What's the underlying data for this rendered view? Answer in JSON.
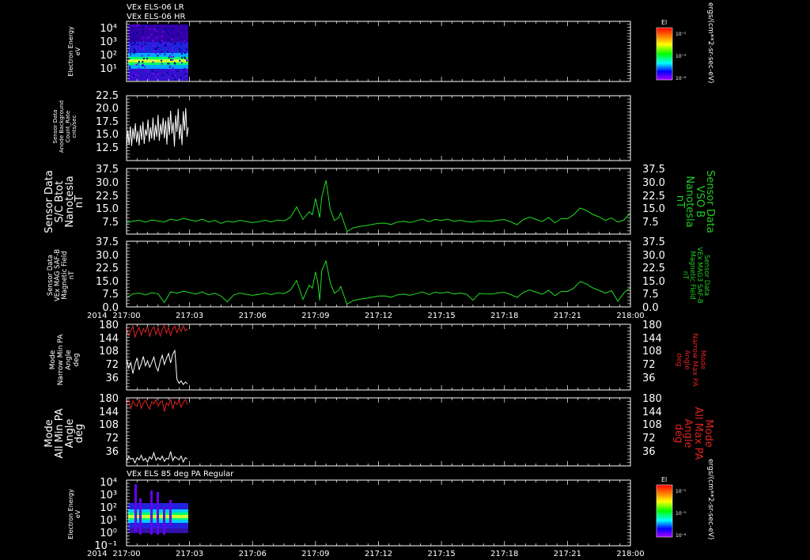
{
  "colors": {
    "background": "#000000",
    "frame": "#ffffff",
    "b_trace": "#22dd22",
    "max_pa": "#dd2222",
    "min_pa": "#ffffff",
    "label_green": "#22cc22",
    "label_red": "#dd2222"
  },
  "header": {
    "line1": "VEx ELS-06 LR",
    "line2": "VEx ELS-06 HR",
    "panel6_title": "VEx ELS 85 deg PA Regular"
  },
  "panels": [
    {
      "id": "p1",
      "ylabel": [
        "Electron Energy",
        "eV"
      ],
      "yticks": [
        "10⁴",
        "10³",
        "10²",
        "10¹"
      ],
      "colorbar": {
        "title": "El",
        "ticks": [
          "10⁻¹",
          "10⁻⁵",
          "10⁻⁹"
        ]
      },
      "units": "ergs/(cm**2-sr-sec-eV)"
    },
    {
      "id": "p2",
      "ylabel": [
        "Sensor Data",
        "Anode Background",
        "Count_Rate",
        "cnts/sec"
      ],
      "yticks": [
        "22.5",
        "20.0",
        "17.5",
        "15.0",
        "12.5"
      ]
    },
    {
      "id": "p3",
      "ylabel": [
        "Sensor Data",
        "S/C Btot",
        "Nanotesla",
        "nT"
      ],
      "yticks": [
        "37.5",
        "30.0",
        "22.5",
        "15.0",
        "7.5"
      ],
      "ylabel_right": [
        "Sensor Data",
        "VSO B",
        "Nanotesla",
        "nT"
      ]
    },
    {
      "id": "p4",
      "ylabel": [
        "Sensor Data",
        "VEx MAG SAF-B",
        "Magnetic Field",
        "nT"
      ],
      "yticks": [
        "37.5",
        "30.0",
        "22.5",
        "15.0",
        "7.5",
        "0.0"
      ],
      "ylabel_right": [
        "Sensor Data",
        "VEx MAG3 SAF-B",
        "Magnetic Field",
        "nT"
      ]
    },
    {
      "id": "p5",
      "ylabel": [
        "Mode",
        "Narrow Min PA",
        "Angle",
        "deg"
      ],
      "yticks": [
        "180",
        "144",
        "108",
        "72",
        "36"
      ],
      "ylabel_right": [
        "Mode",
        "Narrow Max PA",
        "Angle",
        "deg"
      ]
    },
    {
      "id": "p6",
      "ylabel": [
        "Mode",
        "All Min PA",
        "Angle",
        "deg"
      ],
      "yticks": [
        "180",
        "144",
        "108",
        "72",
        "36"
      ],
      "ylabel_right": [
        "Mode",
        "All Max PA",
        "Angle",
        "deg"
      ]
    },
    {
      "id": "p7",
      "ylabel": [
        "Electron Energy",
        "eV"
      ],
      "yticks": [
        "10⁴",
        "10³",
        "10²",
        "10¹",
        "10⁰",
        "10⁻¹"
      ],
      "colorbar": {
        "title": "El",
        "ticks": [
          "10⁻¹",
          "10⁻⁵",
          "10⁻⁹"
        ]
      },
      "units": "ergs/(cm**2-sr-sec-eV)"
    }
  ],
  "xaxis": {
    "year": "2014",
    "ticks": [
      "217:00",
      "217:03",
      "217:06",
      "217:09",
      "217:12",
      "217:15",
      "217:18",
      "217:21",
      "218:00"
    ]
  },
  "chart_data": [
    {
      "type": "heatmap",
      "panel": "p1",
      "title": "VEx ELS-06 LR",
      "x_range": [
        "217:00",
        "217:03"
      ],
      "y_range": [
        "10¹",
        "10⁴"
      ],
      "ylabel": "Electron Energy eV",
      "y_scale": "log",
      "legend": "colorbar right"
    },
    {
      "type": "line",
      "panel": "p2",
      "ylabel": "Sensor Data Anode Background Count_Rate cnts/sec",
      "ylim": [
        10,
        22.5
      ],
      "x": [
        0.0,
        0.06,
        0.12,
        0.18,
        0.24,
        0.3,
        0.36,
        0.42,
        0.48,
        0.54,
        0.6,
        0.66,
        0.72,
        0.78,
        0.84,
        0.9,
        0.96,
        1.02,
        1.08,
        1.14,
        1.2,
        1.26,
        1.32,
        1.38,
        1.44,
        1.5,
        1.56,
        1.62,
        1.68,
        1.74,
        1.8,
        1.86,
        1.92,
        1.98,
        2.04,
        2.1,
        2.16,
        2.22,
        2.28,
        2.34,
        2.4,
        2.46,
        2.52,
        2.58,
        2.64,
        2.7,
        2.76,
        2.82,
        2.88,
        2.94
      ],
      "series": [
        {
          "values": [
            12.3,
            15.8,
            13.0,
            16.6,
            12.8,
            16.2,
            14.1,
            17.2,
            13.5,
            15.7,
            12.9,
            16.8,
            14.0,
            17.5,
            13.2,
            16.0,
            14.8,
            17.9,
            13.6,
            16.4,
            14.2,
            18.3,
            13.9,
            16.9,
            14.6,
            18.8,
            13.8,
            17.1,
            15.0,
            18.2,
            14.3,
            17.7,
            13.1,
            18.4,
            14.9,
            19.6,
            15.2,
            17.4,
            12.7,
            18.7,
            15.5,
            20.0,
            14.1,
            17.0,
            13.0,
            19.5,
            15.8,
            20.1,
            14.6,
            16.4
          ]
        }
      ]
    },
    {
      "type": "line",
      "panel": "p3",
      "ylabel": "Sensor Data S/C Btot Nanotesla nT",
      "ylim": [
        0,
        37.5
      ],
      "x": [
        0.0,
        0.3,
        0.6,
        0.9,
        1.2,
        1.5,
        1.8,
        2.1,
        2.4,
        2.7,
        3.0,
        3.3,
        3.6,
        3.9,
        4.2,
        4.5,
        4.8,
        5.1,
        5.4,
        5.7,
        6.0,
        6.3,
        6.6,
        6.9,
        7.2,
        7.5,
        7.8,
        8.1,
        8.4,
        8.7,
        8.85,
        9.0,
        9.1,
        9.2,
        9.3,
        9.5,
        9.7,
        9.9,
        10.1,
        10.2,
        10.5,
        10.8,
        11.1,
        11.4,
        11.7,
        12.0,
        12.3,
        12.6,
        12.9,
        13.2,
        13.5,
        13.8,
        14.1,
        14.4,
        14.7,
        15.0,
        15.3,
        15.6,
        15.9,
        16.2,
        16.5,
        16.8,
        17.1,
        17.4,
        17.7,
        18.0,
        18.3,
        18.6,
        18.9,
        19.2,
        19.5,
        19.8,
        20.1,
        20.4,
        20.7,
        21.0,
        21.3,
        21.6,
        21.9,
        22.2,
        22.5,
        22.8,
        23.1,
        23.4,
        23.7,
        24.0
      ],
      "series": [
        {
          "values": [
            6.5,
            7.4,
            7.9,
            6.8,
            8.1,
            7.5,
            7.0,
            8.6,
            7.8,
            9.0,
            8.2,
            7.3,
            8.6,
            6.9,
            7.8,
            6.2,
            7.4,
            6.8,
            7.9,
            7.2,
            6.6,
            7.1,
            7.9,
            7.0,
            8.1,
            7.6,
            9.5,
            15.5,
            8.4,
            12.8,
            11.1,
            20.4,
            15.2,
            9.4,
            21.2,
            30.7,
            14.2,
            7.8,
            9.4,
            12.1,
            1.6,
            3.6,
            4.4,
            4.9,
            5.5,
            6.2,
            6.3,
            5.5,
            6.9,
            7.3,
            6.6,
            7.6,
            8.6,
            7.1,
            8.4,
            7.8,
            8.6,
            7.3,
            7.9,
            7.2,
            6.8,
            7.7,
            7.4,
            7.3,
            8.0,
            8.3,
            7.0,
            5.4,
            8.3,
            9.7,
            8.4,
            7.2,
            9.5,
            6.4,
            8.8,
            8.8,
            11.1,
            14.9,
            13.5,
            11.3,
            9.9,
            7.8,
            9.3,
            6.8,
            8.2,
            12.0
          ]
        }
      ]
    },
    {
      "type": "line",
      "panel": "p4",
      "ylabel": "Sensor Data VEx MAG SAF-B Magnetic Field nT",
      "ylim": [
        0,
        37.5
      ],
      "x": [
        0.0,
        0.3,
        0.6,
        0.9,
        1.2,
        1.5,
        1.8,
        2.1,
        2.4,
        2.7,
        3.0,
        3.3,
        3.6,
        3.9,
        4.2,
        4.5,
        4.8,
        5.1,
        5.4,
        5.7,
        6.0,
        6.3,
        6.6,
        6.9,
        7.2,
        7.5,
        7.8,
        8.1,
        8.4,
        8.7,
        8.85,
        9.0,
        9.1,
        9.2,
        9.3,
        9.5,
        9.7,
        9.9,
        10.1,
        10.2,
        10.5,
        10.8,
        11.1,
        11.4,
        11.7,
        12.0,
        12.3,
        12.6,
        12.9,
        13.2,
        13.5,
        13.8,
        14.1,
        14.4,
        14.7,
        15.0,
        15.3,
        15.6,
        15.9,
        16.2,
        16.5,
        16.8,
        17.1,
        17.4,
        17.7,
        18.0,
        18.3,
        18.6,
        18.9,
        19.2,
        19.5,
        19.8,
        20.1,
        20.4,
        20.7,
        21.0,
        21.3,
        21.6,
        21.9,
        22.2,
        22.5,
        22.8,
        23.1,
        23.4,
        23.7,
        24.0
      ],
      "series": [
        {
          "values": [
            5.3,
            7.4,
            7.9,
            6.8,
            8.1,
            7.5,
            2.5,
            8.6,
            7.8,
            9.0,
            8.2,
            7.3,
            8.6,
            6.9,
            7.8,
            6.2,
            2.9,
            6.8,
            7.9,
            7.2,
            6.6,
            7.1,
            7.9,
            7.0,
            8.1,
            7.6,
            9.5,
            15.1,
            4.3,
            12.4,
            10.7,
            20.0,
            14.8,
            3.7,
            20.8,
            26.3,
            13.8,
            7.8,
            9.4,
            11.7,
            1.6,
            3.6,
            4.4,
            4.9,
            5.5,
            6.2,
            6.3,
            5.5,
            6.9,
            7.3,
            6.6,
            7.6,
            8.6,
            7.1,
            8.4,
            7.8,
            8.6,
            7.3,
            7.9,
            7.2,
            3.8,
            7.7,
            7.4,
            7.3,
            8.0,
            8.3,
            7.0,
            5.4,
            8.3,
            9.7,
            8.4,
            7.2,
            9.5,
            6.4,
            8.8,
            8.8,
            10.7,
            14.5,
            13.1,
            10.9,
            9.5,
            7.8,
            9.3,
            3.2,
            8.2,
            11.1
          ]
        }
      ]
    },
    {
      "type": "line",
      "panel": "p5",
      "ylabel": "Mode Narrow Min PA Angle deg",
      "ylim": [
        0,
        180
      ],
      "x": [
        0.0,
        0.1,
        0.2,
        0.3,
        0.4,
        0.5,
        0.6,
        0.7,
        0.8,
        0.9,
        1.0,
        1.1,
        1.2,
        1.3,
        1.4,
        1.5,
        1.6,
        1.7,
        1.8,
        1.9,
        2.0,
        2.1,
        2.2,
        2.3,
        2.4,
        2.5,
        2.6,
        2.7,
        2.8,
        2.9
      ],
      "series": [
        {
          "name": "Narrow Max PA",
          "values": [
            170,
            148,
            162,
            175,
            145,
            160,
            172,
            150,
            168,
            158,
            176,
            146,
            165,
            174,
            152,
            170,
            148,
            166,
            177,
            155,
            171,
            149,
            168,
            175,
            157,
            172,
            160,
            176,
            162,
            168
          ]
        },
        {
          "name": "Narrow Min PA",
          "values": [
            85,
            60,
            75,
            45,
            70,
            88,
            55,
            72,
            92,
            66,
            80,
            62,
            75,
            90,
            64,
            52,
            78,
            95,
            70,
            86,
            100,
            74,
            98,
            108,
            30,
            18,
            25,
            15,
            22,
            17
          ]
        }
      ]
    },
    {
      "type": "line",
      "panel": "p6",
      "ylabel": "Mode All Min PA Angle deg",
      "ylim": [
        0,
        180
      ],
      "x": [
        0.0,
        0.1,
        0.2,
        0.3,
        0.4,
        0.5,
        0.6,
        0.7,
        0.8,
        0.9,
        1.0,
        1.1,
        1.2,
        1.3,
        1.4,
        1.5,
        1.6,
        1.7,
        1.8,
        1.9,
        2.0,
        2.1,
        2.2,
        2.3,
        2.4,
        2.5,
        2.6,
        2.7,
        2.8,
        2.9
      ],
      "series": [
        {
          "name": "All Max PA",
          "values": [
            165,
            176,
            150,
            172,
            162,
            158,
            177,
            152,
            166,
            174,
            160,
            150,
            170,
            164,
            176,
            158,
            168,
            172,
            144,
            166,
            160,
            177,
            150,
            170,
            163,
            174,
            155,
            168,
            176,
            162
          ]
        },
        {
          "name": "All Min PA",
          "values": [
            12,
            25,
            18,
            20,
            8,
            22,
            16,
            28,
            14,
            20,
            10,
            24,
            18,
            35,
            15,
            22,
            16,
            26,
            12,
            20,
            18,
            38,
            14,
            24,
            20,
            16,
            26,
            10,
            22,
            18
          ]
        }
      ]
    },
    {
      "type": "heatmap",
      "panel": "p7",
      "title": "VEx ELS 85 deg PA Regular",
      "x_range": [
        "217:00",
        "217:03"
      ],
      "y_range": [
        "10⁻¹",
        "10⁴"
      ],
      "ylabel": "Electron Energy eV",
      "y_scale": "log",
      "legend": "colorbar right"
    }
  ]
}
